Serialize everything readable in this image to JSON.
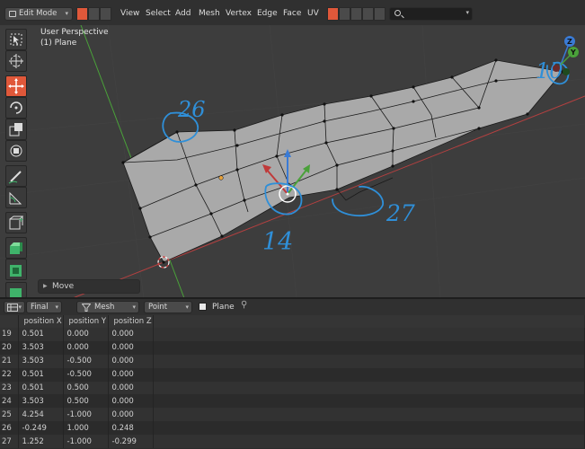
{
  "header": {
    "mode_label": "Edit Mode",
    "menus": [
      "View",
      "Select",
      "Add",
      "Mesh",
      "Vertex",
      "Edge",
      "Face",
      "UV"
    ]
  },
  "viewport": {
    "title": "User Perspective",
    "subtitle": "(1) Plane",
    "gizmo_labels": {
      "z": "Z",
      "y": "Y"
    },
    "last_operator": "Move",
    "annotations": [
      "26",
      "10",
      "14",
      "27"
    ]
  },
  "spreadsheet": {
    "evaluation_state": "Final",
    "data_type": "Mesh",
    "domain": "Point",
    "object_name": "Plane",
    "columns": [
      "position X",
      "position Y",
      "position Z"
    ],
    "rows": [
      [
        "19",
        "0.501",
        "0.000",
        "0.000"
      ],
      [
        "20",
        "3.503",
        "0.000",
        "0.000"
      ],
      [
        "21",
        "3.503",
        "-0.500",
        "0.000"
      ],
      [
        "22",
        "0.501",
        "-0.500",
        "0.000"
      ],
      [
        "23",
        "0.501",
        "0.500",
        "0.000"
      ],
      [
        "24",
        "3.503",
        "0.500",
        "0.000"
      ],
      [
        "25",
        "4.254",
        "-1.000",
        "0.000"
      ],
      [
        "26",
        "-0.249",
        "1.000",
        "0.248"
      ],
      [
        "27",
        "1.252",
        "-1.000",
        "-0.299"
      ]
    ]
  },
  "colors": {
    "accent": "#e0583a",
    "annotation": "#2f8fd8",
    "x_axis": "#b44040",
    "y_axis": "#4aa13a"
  }
}
